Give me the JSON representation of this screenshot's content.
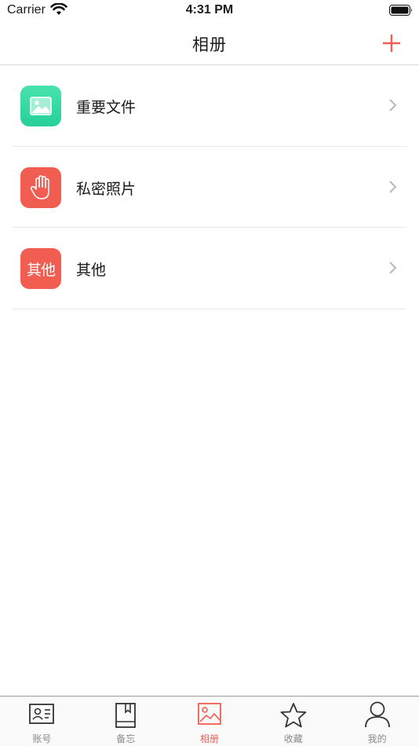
{
  "status_bar": {
    "carrier": "Carrier",
    "time": "4:31 PM"
  },
  "nav": {
    "title": "相册",
    "add_icon": "plus-icon"
  },
  "albums": [
    {
      "label": "重要文件",
      "icon": "image-icon",
      "icon_color": "#2fd8a0"
    },
    {
      "label": "私密照片",
      "icon": "hand-icon",
      "icon_color": "#f25d52"
    },
    {
      "label": "其他",
      "icon": "text-badge",
      "icon_text": "其他",
      "icon_color": "#f25d52"
    }
  ],
  "tabs": [
    {
      "label": "账号",
      "icon": "id-card-icon",
      "active": false
    },
    {
      "label": "备忘",
      "icon": "bookmark-book-icon",
      "active": false
    },
    {
      "label": "相册",
      "icon": "image-icon",
      "active": true
    },
    {
      "label": "收藏",
      "icon": "star-icon",
      "active": false
    },
    {
      "label": "我的",
      "icon": "user-icon",
      "active": false
    }
  ],
  "colors": {
    "accent": "#f25d52",
    "green": "#2fd8a0",
    "inactive": "#8a8a8a"
  }
}
